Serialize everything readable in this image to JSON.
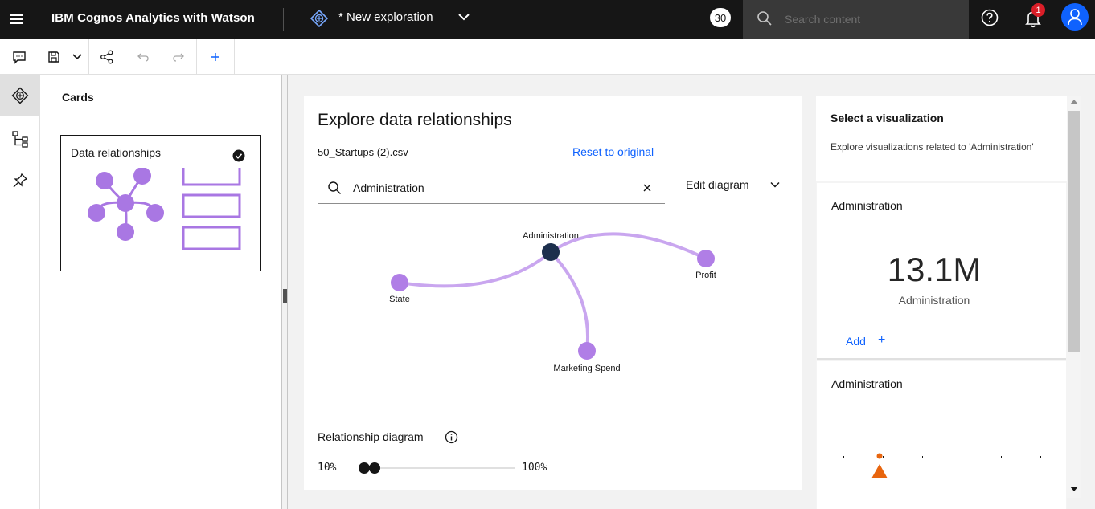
{
  "header": {
    "app_title": "IBM Cognos Analytics with Watson",
    "exploration_title": "* New exploration",
    "count_badge": "30",
    "search_placeholder": "Search content",
    "notification_count": "1"
  },
  "toolbar": {
    "icons": [
      "comment-icon",
      "save-icon",
      "chevron-down-icon",
      "share-icon",
      "undo-icon",
      "redo-icon",
      "add-icon"
    ]
  },
  "rail": {
    "icons": [
      "explore-icon",
      "hierarchy-icon",
      "pin-icon"
    ]
  },
  "cards_panel": {
    "title": "Cards",
    "card_label": "Data relationships"
  },
  "explore": {
    "title": "Explore data relationships",
    "file_name": "50_Startups (2).csv",
    "reset_label": "Reset to original",
    "search_value": "Administration",
    "edit_label": "Edit diagram",
    "nodes": {
      "center": "Administration",
      "state": "State",
      "profit": "Profit",
      "marketing": "Marketing Spend"
    },
    "relationship_label": "Relationship diagram",
    "slider_min": "10%",
    "slider_max": "100%",
    "slider_value_fraction": 0.1
  },
  "viz": {
    "title": "Select a visualization",
    "subtitle": "Explore visualizations related to 'Administration'",
    "card1_title": "Administration",
    "kpi_value": "13.1M",
    "kpi_caption": "Administration",
    "add_label": "Add",
    "card2_title": "Administration"
  },
  "colors": {
    "accent": "#0f62fe",
    "node": "#b07ee6",
    "center_node": "#1c2f4d",
    "marker": "#e8650e"
  }
}
